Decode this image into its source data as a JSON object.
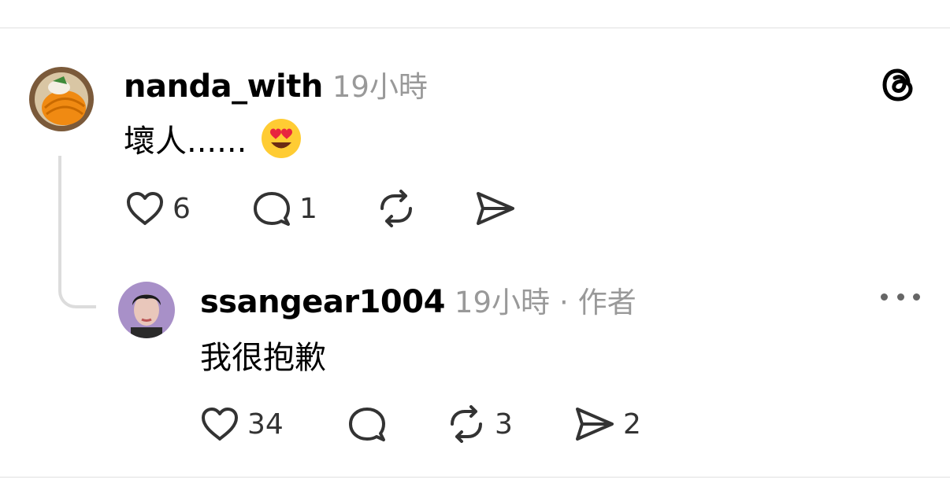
{
  "comment": {
    "username": "nanda_with",
    "time": "19小時",
    "text": "壞人......",
    "emoji": "smiling-face-with-heart-eyes",
    "likes": "6",
    "replies": "1"
  },
  "reply": {
    "username": "ssangear1004",
    "time": "19小時",
    "separator": "·",
    "author_label": "作者",
    "text": "我很抱歉",
    "likes": "34",
    "reposts": "3",
    "shares": "2"
  },
  "icons": [
    "threads-logo-icon",
    "heart-icon",
    "comment-icon",
    "repost-icon",
    "send-icon",
    "more-icon"
  ],
  "colors": {
    "text": "#000000",
    "muted": "#999999",
    "divider": "#e0e0e0",
    "icon": "#333333"
  }
}
